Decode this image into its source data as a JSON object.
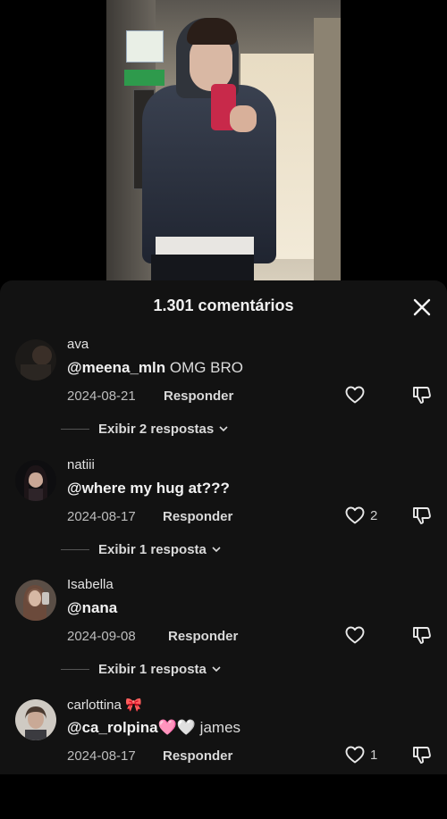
{
  "sheet": {
    "title": "1.301 comentários"
  },
  "comments": [
    {
      "username": "ava",
      "mention": "@meena_mln",
      "text": " OMG BRO",
      "date": "2024-08-21",
      "reply_label": "Responder",
      "likes": "",
      "replies_label": "Exibir 2 respostas"
    },
    {
      "username": "natiii",
      "mention": "@where my hug at???",
      "text": "",
      "date": "2024-08-17",
      "reply_label": "Responder",
      "likes": "2",
      "replies_label": "Exibir 1 resposta"
    },
    {
      "username": "Isabella",
      "mention": "@nana",
      "text": "",
      "date": "2024-09-08",
      "reply_label": "Responder",
      "likes": "",
      "replies_label": "Exibir 1 resposta"
    },
    {
      "username": "carlottina 🎀",
      "mention": "@ca_rolpina",
      "text": "🩷🤍 james",
      "date": "2024-08-17",
      "reply_label": "Responder",
      "likes": "1",
      "replies_label": ""
    }
  ],
  "icons": {
    "close": "close-icon",
    "like": "heart-outline-icon",
    "dislike": "thumbs-down-icon",
    "chevron": "chevron-down-icon"
  },
  "colors": {
    "sheet_bg": "#121212",
    "text_primary": "#f2f2f2",
    "text_secondary": "#bdbdbd"
  }
}
